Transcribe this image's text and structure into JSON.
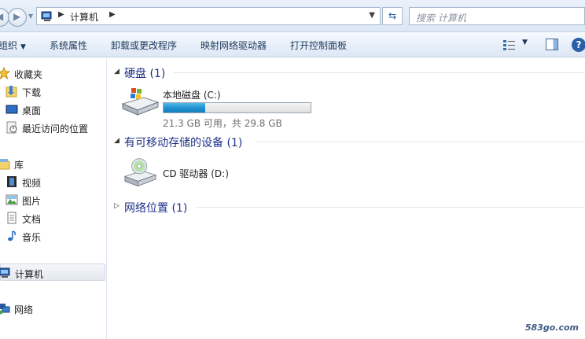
{
  "address": {
    "crumb": "计算机",
    "search_placeholder": "搜索 计算机"
  },
  "toolbar": {
    "organize": "组织",
    "system_properties": "系统属性",
    "uninstall": "卸载或更改程序",
    "map_drive": "映射网络驱动器",
    "control_panel": "打开控制面板"
  },
  "nav": {
    "favorites": "收藏夹",
    "downloads": "下载",
    "desktop": "桌面",
    "recent": "最近访问的位置",
    "libraries": "库",
    "videos": "视频",
    "pictures": "图片",
    "documents": "文档",
    "music": "音乐",
    "computer": "计算机",
    "network": "网络"
  },
  "groups": {
    "hdd": "硬盘 (1)",
    "removable": "有可移动存储的设备 (1)",
    "network_locations": "网络位置 (1)"
  },
  "drives": {
    "c_name": "本地磁盘 (C:)",
    "c_size": "21.3 GB 可用，共 29.8 GB",
    "c_used_fraction": 0.285,
    "d_name": "CD 驱动器 (D:)"
  },
  "colors": {
    "group_title": "#1e3287",
    "bar_fill": "#1e8fcf"
  },
  "watermark": "583go.com"
}
